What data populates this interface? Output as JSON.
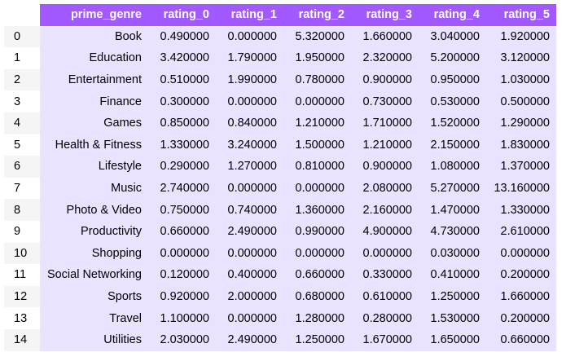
{
  "table": {
    "columns": [
      "",
      "prime_genre",
      "rating_0",
      "rating_1",
      "rating_2",
      "rating_3",
      "rating_4",
      "rating_5"
    ],
    "rows": [
      {
        "index": "0",
        "prime_genre": "Book",
        "rating_0": "0.490000",
        "rating_1": "0.000000",
        "rating_2": "5.320000",
        "rating_3": "1.660000",
        "rating_4": "3.040000",
        "rating_5": "1.920000"
      },
      {
        "index": "1",
        "prime_genre": "Education",
        "rating_0": "3.420000",
        "rating_1": "1.790000",
        "rating_2": "1.950000",
        "rating_3": "2.320000",
        "rating_4": "5.200000",
        "rating_5": "3.120000"
      },
      {
        "index": "2",
        "prime_genre": "Entertainment",
        "rating_0": "0.510000",
        "rating_1": "1.990000",
        "rating_2": "0.780000",
        "rating_3": "0.900000",
        "rating_4": "0.950000",
        "rating_5": "1.030000"
      },
      {
        "index": "3",
        "prime_genre": "Finance",
        "rating_0": "0.300000",
        "rating_1": "0.000000",
        "rating_2": "0.000000",
        "rating_3": "0.730000",
        "rating_4": "0.530000",
        "rating_5": "0.500000"
      },
      {
        "index": "4",
        "prime_genre": "Games",
        "rating_0": "0.850000",
        "rating_1": "0.840000",
        "rating_2": "1.210000",
        "rating_3": "1.710000",
        "rating_4": "1.520000",
        "rating_5": "1.290000"
      },
      {
        "index": "5",
        "prime_genre": "Health & Fitness",
        "rating_0": "1.330000",
        "rating_1": "3.240000",
        "rating_2": "1.500000",
        "rating_3": "1.210000",
        "rating_4": "2.150000",
        "rating_5": "1.830000"
      },
      {
        "index": "6",
        "prime_genre": "Lifestyle",
        "rating_0": "0.290000",
        "rating_1": "1.270000",
        "rating_2": "0.810000",
        "rating_3": "0.900000",
        "rating_4": "1.080000",
        "rating_5": "1.370000"
      },
      {
        "index": "7",
        "prime_genre": "Music",
        "rating_0": "2.740000",
        "rating_1": "0.000000",
        "rating_2": "0.000000",
        "rating_3": "2.080000",
        "rating_4": "5.270000",
        "rating_5": "13.160000"
      },
      {
        "index": "8",
        "prime_genre": "Photo & Video",
        "rating_0": "0.750000",
        "rating_1": "0.740000",
        "rating_2": "1.360000",
        "rating_3": "2.160000",
        "rating_4": "1.470000",
        "rating_5": "1.330000"
      },
      {
        "index": "9",
        "prime_genre": "Productivity",
        "rating_0": "0.660000",
        "rating_1": "2.490000",
        "rating_2": "0.990000",
        "rating_3": "4.900000",
        "rating_4": "4.730000",
        "rating_5": "2.610000"
      },
      {
        "index": "10",
        "prime_genre": "Shopping",
        "rating_0": "0.000000",
        "rating_1": "0.000000",
        "rating_2": "0.000000",
        "rating_3": "0.000000",
        "rating_4": "0.030000",
        "rating_5": "0.000000"
      },
      {
        "index": "11",
        "prime_genre": "Social Networking",
        "rating_0": "0.120000",
        "rating_1": "0.400000",
        "rating_2": "0.660000",
        "rating_3": "0.330000",
        "rating_4": "0.410000",
        "rating_5": "0.200000"
      },
      {
        "index": "12",
        "prime_genre": "Sports",
        "rating_0": "0.920000",
        "rating_1": "2.000000",
        "rating_2": "0.680000",
        "rating_3": "0.610000",
        "rating_4": "1.250000",
        "rating_5": "1.660000"
      },
      {
        "index": "13",
        "prime_genre": "Travel",
        "rating_0": "1.100000",
        "rating_1": "0.000000",
        "rating_2": "1.280000",
        "rating_3": "0.280000",
        "rating_4": "1.530000",
        "rating_5": "0.200000"
      },
      {
        "index": "14",
        "prime_genre": "Utilities",
        "rating_0": "2.030000",
        "rating_1": "2.490000",
        "rating_2": "1.250000",
        "rating_3": "1.670000",
        "rating_4": "1.650000",
        "rating_5": "0.660000"
      }
    ]
  },
  "colors": {
    "header_bg": "#a259ff",
    "header_text": "#ffffff",
    "cell_bg": "#eae2ff",
    "index_stripe": "#f5f5f5"
  }
}
